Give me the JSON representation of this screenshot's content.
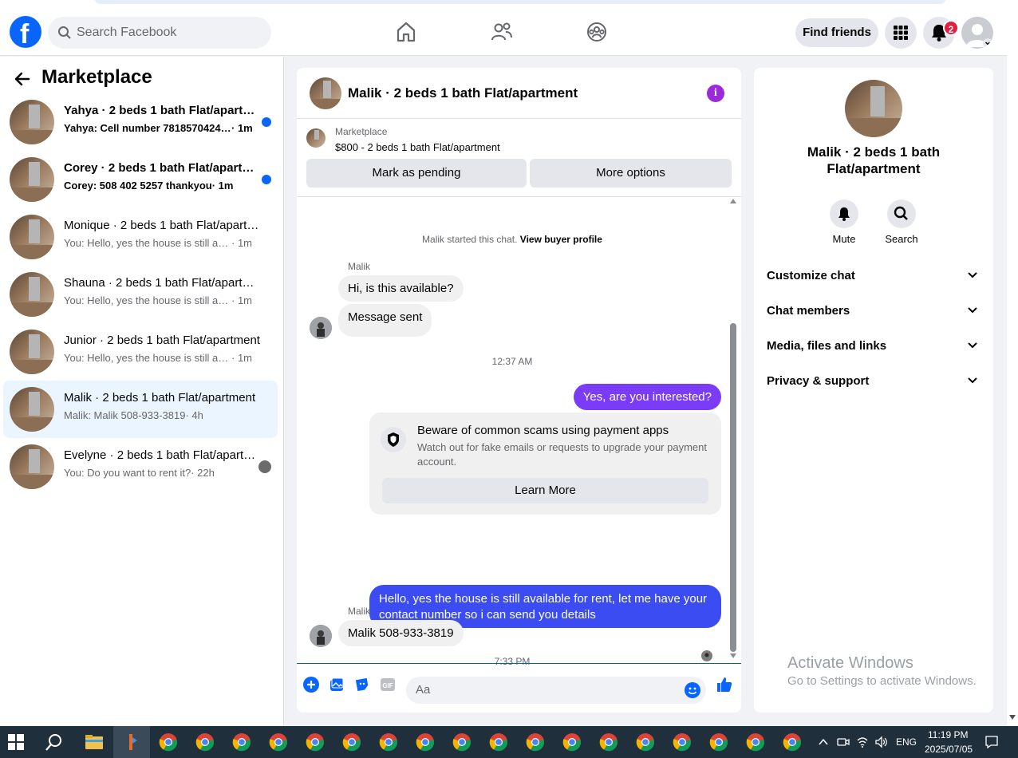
{
  "header": {
    "search_placeholder": "Search Facebook",
    "find_friends": "Find friends",
    "notification_count": "2"
  },
  "sidebar": {
    "title": "Marketplace",
    "conversations": [
      {
        "name": "Yahya · 2 beds 1 bath Flat/apartment",
        "preview": "Yahya: Cell number 7818570424 N...",
        "time": "· 1m",
        "unread": true
      },
      {
        "name": "Corey · 2 beds 1 bath Flat/apartment",
        "preview": "Corey: 508 402 5257 thankyou",
        "time": "· 1m",
        "unread": true
      },
      {
        "name": "Monique · 2 beds 1 bath Flat/apartment",
        "preview": "You: Hello, yes the house is still availa...",
        "time": "· 1m",
        "unread": false
      },
      {
        "name": "Shauna · 2 beds 1 bath Flat/apartment",
        "preview": "You: Hello, yes the house is still availa...",
        "time": "· 1m",
        "unread": false
      },
      {
        "name": "Junior · 2 beds 1 bath Flat/apartment",
        "preview": "You: Hello, yes the house is still availa...",
        "time": "· 1m",
        "unread": false
      },
      {
        "name": "Malik · 2 beds 1 bath Flat/apartment",
        "preview": "Malik: Malik 508-933-3819",
        "time": "· 4h",
        "unread": false,
        "active": true
      },
      {
        "name": "Evelyne · 2 beds 1 bath Flat/apartment",
        "preview": "You: Do you want to rent it?",
        "time": "· 22h",
        "unread": false
      }
    ]
  },
  "chat": {
    "title": "Malik · 2 beds 1 bath Flat/apartment",
    "listing_source": "Marketplace",
    "listing_title": "$800 - 2 beds 1 bath Flat/apartment",
    "mark_pending": "Mark as pending",
    "more_options": "More options",
    "started_text": "Malik started this chat.",
    "view_buyer": "View buyer profile",
    "sender_name": "Malik",
    "msg1": "Hi, is this available?",
    "msg2": "Message sent",
    "time1": "12:37 AM",
    "out1": "Yes, are you interested?",
    "scam_title": "Beware of common scams using payment apps",
    "scam_desc": "Watch out for fake emails or requests to upgrade your payment account.",
    "learn_more": "Learn More",
    "out2": "Hello, yes the house is still available for rent, let me have your contact number so i can send you details",
    "time2": "7:33 PM",
    "msg3": "Malik 508-933-3819",
    "composer_placeholder": "Aa"
  },
  "rpanel": {
    "title": "Malik · 2 beds 1 bath Flat/apartment",
    "mute": "Mute",
    "search": "Search",
    "sections": [
      "Customize chat",
      "Chat members",
      "Media, files and links",
      "Privacy & support"
    ]
  },
  "watermark": {
    "line1": "Activate Windows",
    "line2": "Go to Settings to activate Windows."
  },
  "taskbar": {
    "lang": "ENG",
    "time": "11:19 PM",
    "date": "2025/07/05"
  },
  "colors": {
    "brand": "#0866ff",
    "outgoing_bubble": "#7a3cf6",
    "outgoing_bubble_2": "#3b4df2",
    "badge": "#e41e3f"
  }
}
